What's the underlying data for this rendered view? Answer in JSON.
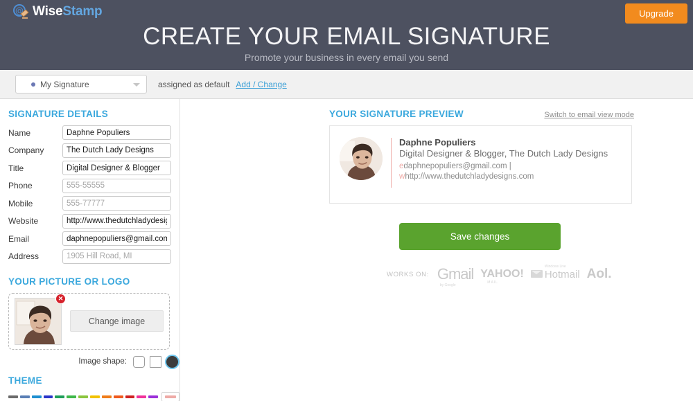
{
  "header": {
    "logo_wise": "Wise",
    "logo_stamp": "Stamp",
    "logo_icon": "at-stamp-icon",
    "upgrade_label": "Upgrade",
    "title": "CREATE YOUR EMAIL SIGNATURE",
    "subtitle": "Promote your business in every email you send",
    "bg_color": "#4d5160",
    "upgrade_color": "#f28b1e"
  },
  "signature_bar": {
    "selected_signature": "My Signature",
    "assigned_text": "assigned as default",
    "add_change_link": "Add / Change",
    "link_color": "#3b9fd6"
  },
  "details": {
    "section_title": "SIGNATURE DETAILS",
    "accent_color": "#3ba8dd",
    "fields": [
      {
        "label": "Name",
        "value": "Daphne Populiers",
        "placeholder": "",
        "filled": true
      },
      {
        "label": "Company",
        "value": "The Dutch Lady Designs",
        "placeholder": "",
        "filled": true
      },
      {
        "label": "Title",
        "value": "Digital Designer & Blogger",
        "placeholder": "",
        "filled": true
      },
      {
        "label": "Phone",
        "value": "",
        "placeholder": "555-55555",
        "filled": false
      },
      {
        "label": "Mobile",
        "value": "",
        "placeholder": "555-77777",
        "filled": false
      },
      {
        "label": "Website",
        "value": "http://www.thedutchladydesigns.c",
        "placeholder": "",
        "filled": true
      },
      {
        "label": "Email",
        "value": "daphnepopuliers@gmail.com",
        "placeholder": "",
        "filled": true
      },
      {
        "label": "Address",
        "value": "",
        "placeholder": "1905 Hill Road, MI",
        "filled": false
      }
    ]
  },
  "picture": {
    "section_title": "YOUR PICTURE OR LOGO",
    "change_image_label": "Change image",
    "delete_glyph": "✕",
    "shape_label": "Image shape:",
    "shapes": [
      {
        "name": "rounded-square",
        "selected": false
      },
      {
        "name": "square",
        "selected": false
      },
      {
        "name": "circle",
        "selected": true
      }
    ]
  },
  "theme": {
    "section_title": "THEME",
    "swatches": [
      "#6b6b6b",
      "#5a7fb5",
      "#1e8fd0",
      "#2b35c9",
      "#1f9e5a",
      "#3fb84a",
      "#8bc53f",
      "#f2c200",
      "#f07d1a",
      "#ef5a1e",
      "#cf2222",
      "#f0329a",
      "#9b30d9"
    ],
    "selected_swatch": "#eeaaa6"
  },
  "preview": {
    "title": "YOUR SIGNATURE PREVIEW",
    "switch_link": "Switch to email view mode",
    "accent_color": "#3ba8dd",
    "divider_color": "#eeaaa6",
    "signature": {
      "name": "Daphne Populiers",
      "role": "Digital Designer & Blogger, The Dutch Lady Designs",
      "email_key": "e",
      "email_value": "daphnepopuliers@gmail.com |",
      "web_key": "w",
      "web_value": "http://www.thedutchladydesigns.com"
    },
    "save_label": "Save changes",
    "save_color": "#5aa32e",
    "works_on_label": "WORKS ON:",
    "works_on": [
      {
        "name": "gmail",
        "main": "Gmail",
        "sub": "by Google"
      },
      {
        "name": "yahoo",
        "main": "YAHOO!",
        "sub": "MAIL"
      },
      {
        "name": "hotmail",
        "main": "Hotmail",
        "sub": "Windows Live"
      },
      {
        "name": "aol",
        "main": "Aol.",
        "sub": ""
      }
    ]
  }
}
